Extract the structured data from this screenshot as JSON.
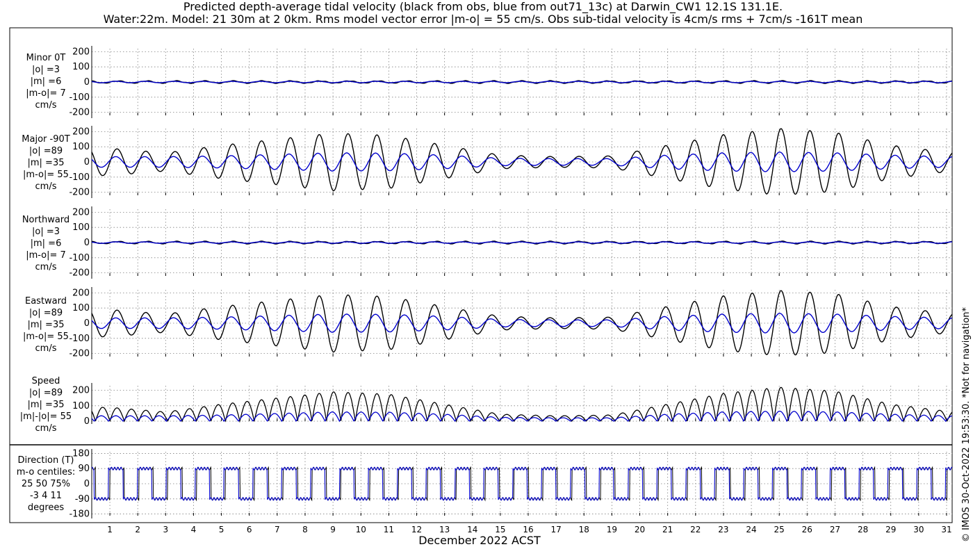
{
  "header": {
    "title_line1": "Predicted depth-average tidal velocity (black from obs, blue from out71_13c) at Darwin_CW1 12.1S 131.1E.",
    "title_line2": "Water:22m. Model: 21 30m at 2 0km. Rms model vector error |m-o| = 55 cm/s. Obs sub-tidal velocity is 4cm/s rms + 7cm/s -161T mean"
  },
  "footer": {
    "xlabel": "December 2022 ACST",
    "credit": "© IMOS 30-Oct-2022 19:53:30. *Not for navigation*"
  },
  "colors": {
    "obs": "#000000",
    "model": "#0000cc",
    "grid": "#808080"
  },
  "chart_data": {
    "type": "line",
    "x_axis": {
      "label": "December 2022 ACST",
      "ticks": [
        "1",
        "2",
        "3",
        "4",
        "5",
        "6",
        "7",
        "8",
        "9",
        "10",
        "11",
        "12",
        "13",
        "14",
        "15",
        "16",
        "17",
        "18",
        "19",
        "20",
        "21",
        "22",
        "23",
        "24",
        "25",
        "26",
        "27",
        "28",
        "29",
        "30",
        "31"
      ],
      "xlim_days": [
        0.35,
        31.2
      ]
    },
    "series_legend": [
      "black from obs",
      "blue from out71_13c"
    ],
    "panels": [
      {
        "label_lines": [
          "Minor 0T",
          "|o| =3",
          "|m| =6",
          "|m-o|= 7",
          "cm/s"
        ],
        "yticks": [
          "200",
          "100",
          "0",
          "-100",
          "-200"
        ],
        "ytick_values": [
          200,
          100,
          0,
          -100,
          -200
        ],
        "ylim": [
          -220,
          220
        ],
        "kind": "component",
        "obs_amplitude": 3,
        "model_amplitude": 6
      },
      {
        "label_lines": [
          "Major -90T",
          "|o| =89",
          "|m| =35",
          "|m-o|= 55",
          "cm/s"
        ],
        "yticks": [
          "200",
          "100",
          "0",
          "-100",
          "-200"
        ],
        "ytick_values": [
          200,
          100,
          0,
          -100,
          -200
        ],
        "ylim": [
          -220,
          220
        ],
        "kind": "component",
        "obs_amplitude": 89,
        "model_amplitude": 35,
        "obs_peak_envelope": [
          [
            1,
            90
          ],
          [
            3,
            60
          ],
          [
            5,
            110
          ],
          [
            7,
            150
          ],
          [
            9,
            190
          ],
          [
            11,
            175
          ],
          [
            13,
            110
          ],
          [
            15,
            45
          ],
          [
            17,
            35
          ],
          [
            19,
            40
          ],
          [
            21,
            110
          ],
          [
            23,
            180
          ],
          [
            25,
            220
          ],
          [
            27,
            195
          ],
          [
            29,
            110
          ],
          [
            31,
            65
          ]
        ],
        "model_peak_envelope": [
          [
            1,
            35
          ],
          [
            3,
            35
          ],
          [
            5,
            40
          ],
          [
            7,
            50
          ],
          [
            9,
            60
          ],
          [
            11,
            58
          ],
          [
            13,
            45
          ],
          [
            15,
            25
          ],
          [
            17,
            22
          ],
          [
            19,
            22
          ],
          [
            21,
            45
          ],
          [
            23,
            60
          ],
          [
            25,
            65
          ],
          [
            27,
            60
          ],
          [
            29,
            45
          ],
          [
            31,
            35
          ]
        ]
      },
      {
        "label_lines": [
          "Northward",
          "|o| =3",
          "|m| =6",
          "|m-o|= 7",
          "cm/s"
        ],
        "yticks": [
          "200",
          "100",
          "0",
          "-100",
          "-200"
        ],
        "ytick_values": [
          200,
          100,
          0,
          -100,
          -200
        ],
        "ylim": [
          -220,
          220
        ],
        "kind": "component",
        "obs_amplitude": 3,
        "model_amplitude": 6
      },
      {
        "label_lines": [
          "Eastward",
          "|o| =89",
          "|m| =35",
          "|m-o|= 55",
          "cm/s"
        ],
        "yticks": [
          "200",
          "100",
          "0",
          "-100",
          "-200"
        ],
        "ytick_values": [
          200,
          100,
          0,
          -100,
          -200
        ],
        "ylim": [
          -220,
          220
        ],
        "kind": "component",
        "obs_amplitude": 89,
        "model_amplitude": 35,
        "obs_peak_envelope": [
          [
            1,
            90
          ],
          [
            3,
            60
          ],
          [
            5,
            110
          ],
          [
            7,
            150
          ],
          [
            9,
            190
          ],
          [
            11,
            175
          ],
          [
            13,
            110
          ],
          [
            15,
            45
          ],
          [
            17,
            35
          ],
          [
            19,
            40
          ],
          [
            21,
            110
          ],
          [
            23,
            180
          ],
          [
            25,
            215
          ],
          [
            27,
            195
          ],
          [
            29,
            110
          ],
          [
            31,
            65
          ]
        ],
        "model_peak_envelope": [
          [
            1,
            35
          ],
          [
            3,
            35
          ],
          [
            5,
            40
          ],
          [
            7,
            50
          ],
          [
            9,
            60
          ],
          [
            11,
            58
          ],
          [
            13,
            45
          ],
          [
            15,
            25
          ],
          [
            17,
            22
          ],
          [
            19,
            22
          ],
          [
            21,
            45
          ],
          [
            23,
            60
          ],
          [
            25,
            65
          ],
          [
            27,
            60
          ],
          [
            29,
            45
          ],
          [
            31,
            35
          ]
        ]
      },
      {
        "label_lines": [
          "Speed",
          "|o| =89",
          "|m| =35",
          "|m|-|o|= 55",
          "cm/s"
        ],
        "yticks": [
          "200",
          "100",
          "0"
        ],
        "ytick_values": [
          200,
          100,
          0
        ],
        "ylim": [
          0,
          230
        ],
        "kind": "speed",
        "obs_amplitude": 89,
        "model_amplitude": 35
      },
      {
        "label_lines": [
          "Direction (T)",
          "m-o centiles:",
          "25  50  75%",
          "-3   4  11",
          "degrees"
        ],
        "yticks": [
          "180",
          "90",
          "0",
          "-90",
          "-180"
        ],
        "ytick_values": [
          180,
          90,
          0,
          -90,
          -180
        ],
        "ylim": [
          -190,
          190
        ],
        "kind": "direction"
      }
    ]
  }
}
